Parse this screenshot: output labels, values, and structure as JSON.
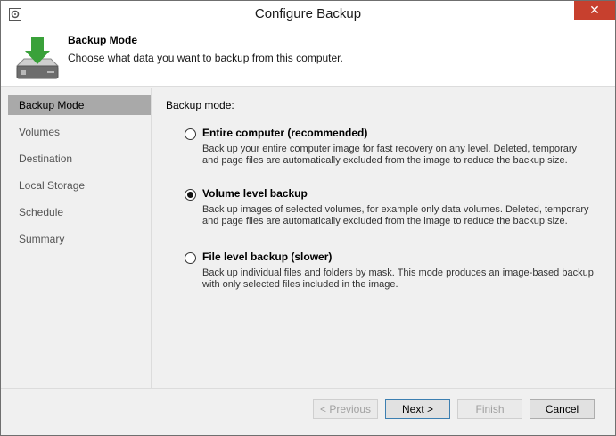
{
  "window": {
    "title": "Configure Backup",
    "close_glyph": "✕"
  },
  "header": {
    "title": "Backup Mode",
    "description": "Choose what data you want to backup from this computer.",
    "icon": "download-disk-icon"
  },
  "sidebar": {
    "items": [
      {
        "label": "Backup Mode",
        "active": true
      },
      {
        "label": "Volumes"
      },
      {
        "label": "Destination"
      },
      {
        "label": "Local Storage"
      },
      {
        "label": "Schedule"
      },
      {
        "label": "Summary"
      }
    ]
  },
  "content": {
    "mode_label": "Backup mode:",
    "options": [
      {
        "title": "Entire computer (recommended)",
        "description": "Back up your entire computer image for fast recovery on any level. Deleted, temporary and page files are automatically excluded from the image to reduce the backup size.",
        "selected": false
      },
      {
        "title": "Volume level backup",
        "description": "Back up images of selected volumes, for example only data volumes. Deleted, temporary and page files are automatically excluded from the image to reduce the backup size.",
        "selected": true
      },
      {
        "title": "File level backup (slower)",
        "description": "Back up individual files and folders by mask. This mode produces an image-based backup with only selected files included in the image.",
        "selected": false
      }
    ]
  },
  "footer": {
    "previous_label": "< Previous",
    "next_label": "Next >",
    "finish_label": "Finish",
    "cancel_label": "Cancel"
  },
  "colors": {
    "close": "#c7402e",
    "sidebar_active": "#a9a9a9",
    "icon_green": "#3aa13a"
  }
}
